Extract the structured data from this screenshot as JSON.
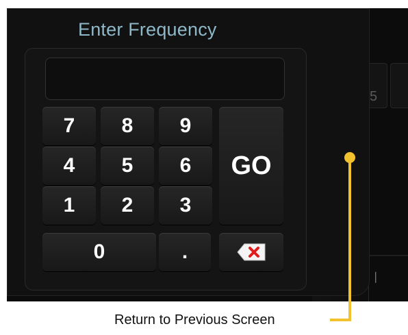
{
  "panel": {
    "title": "Enter Frequency",
    "display_value": ""
  },
  "keys": {
    "row1": [
      "7",
      "8",
      "9"
    ],
    "row2": [
      "4",
      "5",
      "6"
    ],
    "row3": [
      "1",
      "2",
      "3"
    ],
    "zero": "0",
    "dot": ".",
    "go": "GO",
    "delete_icon": "backspace-x-icon"
  },
  "background": {
    "partial_glyph": "5"
  },
  "callout": {
    "label": "Return to Previous Screen",
    "color": "#f2c12e"
  },
  "colors": {
    "title": "#8fb8c8",
    "delete_x": "#e21b1b",
    "key_text": "#ffffff"
  }
}
